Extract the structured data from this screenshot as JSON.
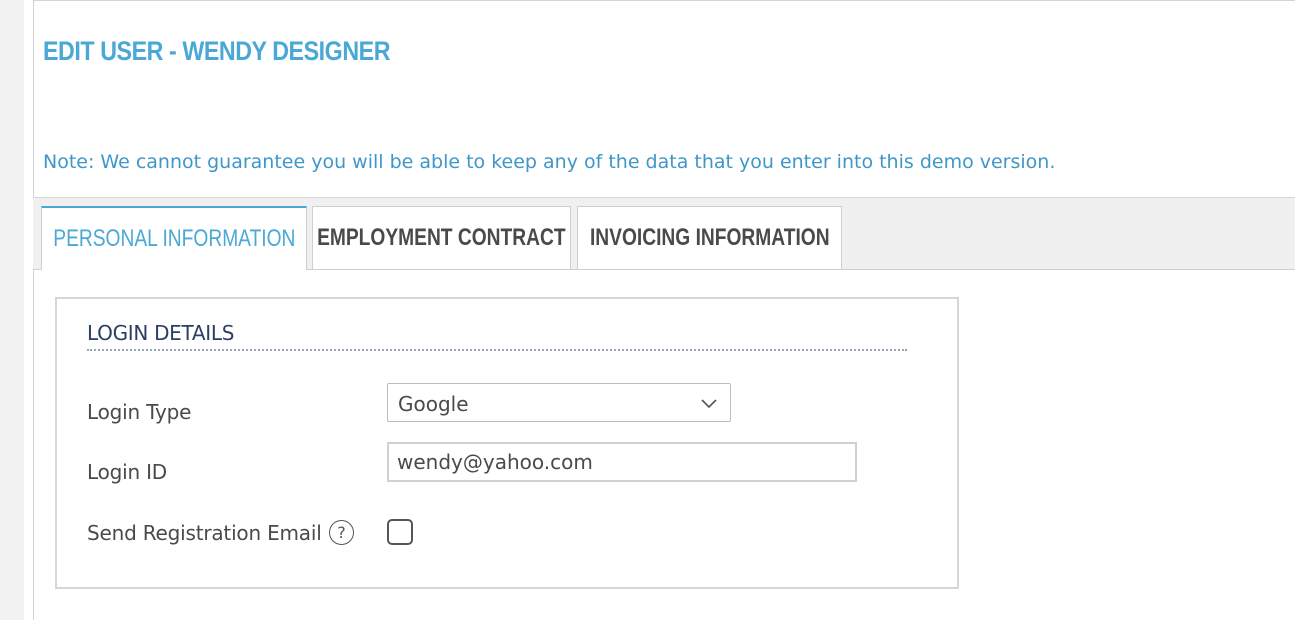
{
  "page": {
    "title": "EDIT USER - WENDY DESIGNER",
    "note": "Note: We cannot guarantee you will be able to keep any of the data that you enter into this demo version."
  },
  "tabs": [
    {
      "label": "PERSONAL INFORMATION",
      "active": true
    },
    {
      "label": "EMPLOYMENT CONTRACT",
      "active": false
    },
    {
      "label": "INVOICING INFORMATION",
      "active": false
    }
  ],
  "login_details": {
    "section_title": "LOGIN DETAILS",
    "login_type": {
      "label": "Login Type",
      "value": "Google"
    },
    "login_id": {
      "label": "Login ID",
      "value": "wendy@yahoo.com"
    },
    "send_registration_email": {
      "label": "Send Registration Email",
      "checked": false,
      "help_icon": "question-circle-icon"
    }
  },
  "colors": {
    "accent": "#4aa8d6",
    "section_title": "#2c3f63",
    "text": "#4a4a4a"
  }
}
